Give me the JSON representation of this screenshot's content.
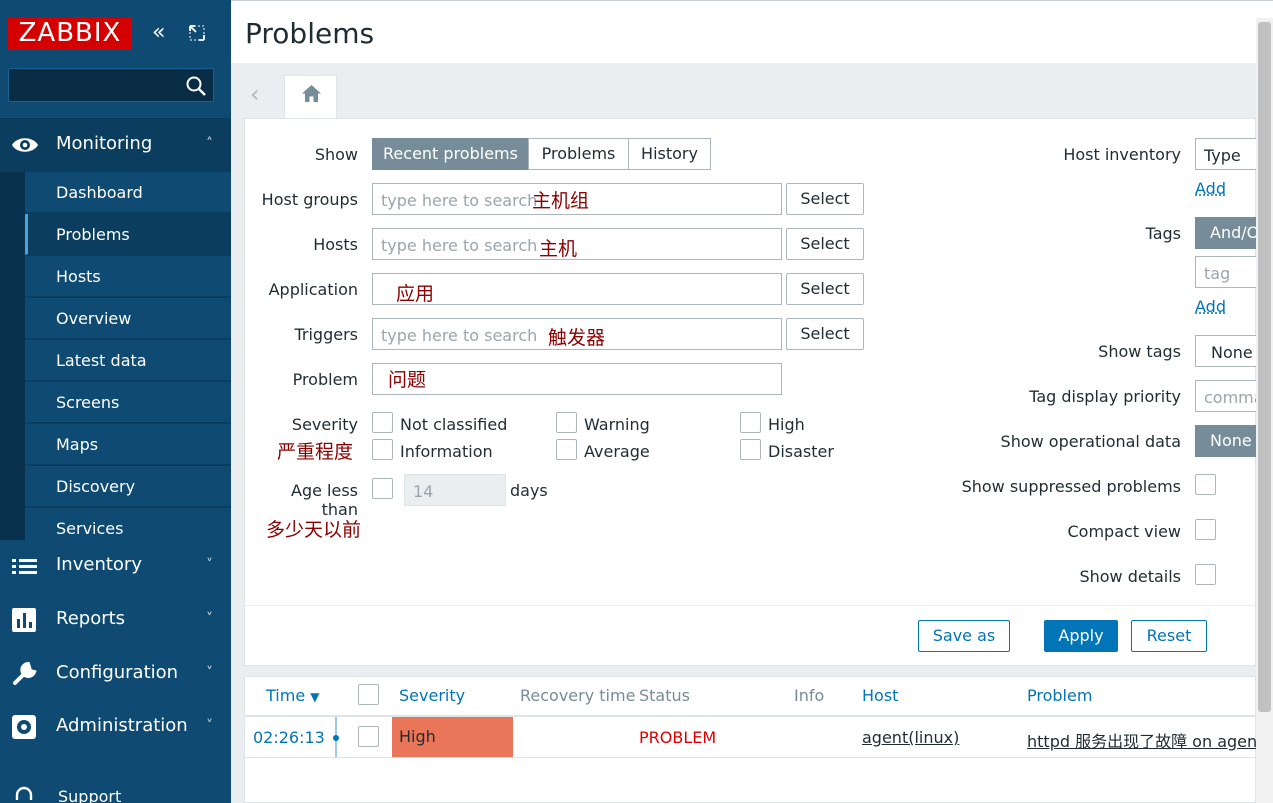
{
  "sidebar": {
    "logo": "ZABBIX",
    "search": {
      "value": "",
      "placeholder": ""
    },
    "monitoring": {
      "label": "Monitoring",
      "expanded": true
    },
    "monitoring_items": [
      "Dashboard",
      "Problems",
      "Hosts",
      "Overview",
      "Latest data",
      "Screens",
      "Maps",
      "Discovery",
      "Services"
    ],
    "active_item": "Problems",
    "sections": [
      "Inventory",
      "Reports",
      "Configuration",
      "Administration"
    ],
    "support": "Support"
  },
  "header": {
    "title": "Problems"
  },
  "filter": {
    "show_label": "Show",
    "show_options": [
      "Recent problems",
      "Problems",
      "History"
    ],
    "show_selected": "Recent problems",
    "host_groups": {
      "label": "Host groups",
      "placeholder": "type here to search",
      "note": "主机组",
      "button": "Select"
    },
    "hosts": {
      "label": "Hosts",
      "placeholder": "type here to search",
      "note": "主机",
      "button": "Select"
    },
    "application": {
      "label": "Application",
      "value": "",
      "note": "应用",
      "button": "Select"
    },
    "triggers": {
      "label": "Triggers",
      "placeholder": "type here to search",
      "note": "触发器",
      "button": "Select"
    },
    "problem": {
      "label": "Problem",
      "value": "",
      "note": "问题"
    },
    "severity": {
      "label": "Severity",
      "note": "严重程度",
      "options": [
        "Not classified",
        "Warning",
        "High",
        "Information",
        "Average",
        "Disaster"
      ]
    },
    "age": {
      "label": "Age less than",
      "value": "14",
      "unit": "days",
      "note": "多少天以前"
    },
    "host_inventory": {
      "label": "Host inventory",
      "type": "Type",
      "add": "Add"
    },
    "tags": {
      "label": "Tags",
      "mode": "And/Or",
      "tag_placeholder": "tag",
      "add": "Add"
    },
    "show_tags": {
      "label": "Show tags",
      "value": "None"
    },
    "tag_priority": {
      "label": "Tag display priority",
      "placeholder": "comma-separated list"
    },
    "operational_data": {
      "label": "Show operational data",
      "value": "None"
    },
    "suppressed": {
      "label": "Show suppressed problems"
    },
    "compact": {
      "label": "Compact view"
    },
    "details": {
      "label": "Show details"
    },
    "buttons": {
      "save_as": "Save as",
      "apply": "Apply",
      "reset": "Reset"
    }
  },
  "table": {
    "columns": [
      "Time",
      "Severity",
      "Recovery time",
      "Status",
      "Info",
      "Host",
      "Problem"
    ],
    "rows": [
      {
        "time": "02:26:13",
        "severity": "High",
        "recovery": "",
        "status": "PROBLEM",
        "info": "",
        "host": "agent(linux)",
        "problem": "httpd 服务出现了故障 on agent(linux)"
      }
    ]
  },
  "colors": {
    "sidebar": "#0e4a72",
    "logo": "#d40000",
    "accent": "#0275b8",
    "high": "#e97659",
    "problem": "#dc0000"
  }
}
